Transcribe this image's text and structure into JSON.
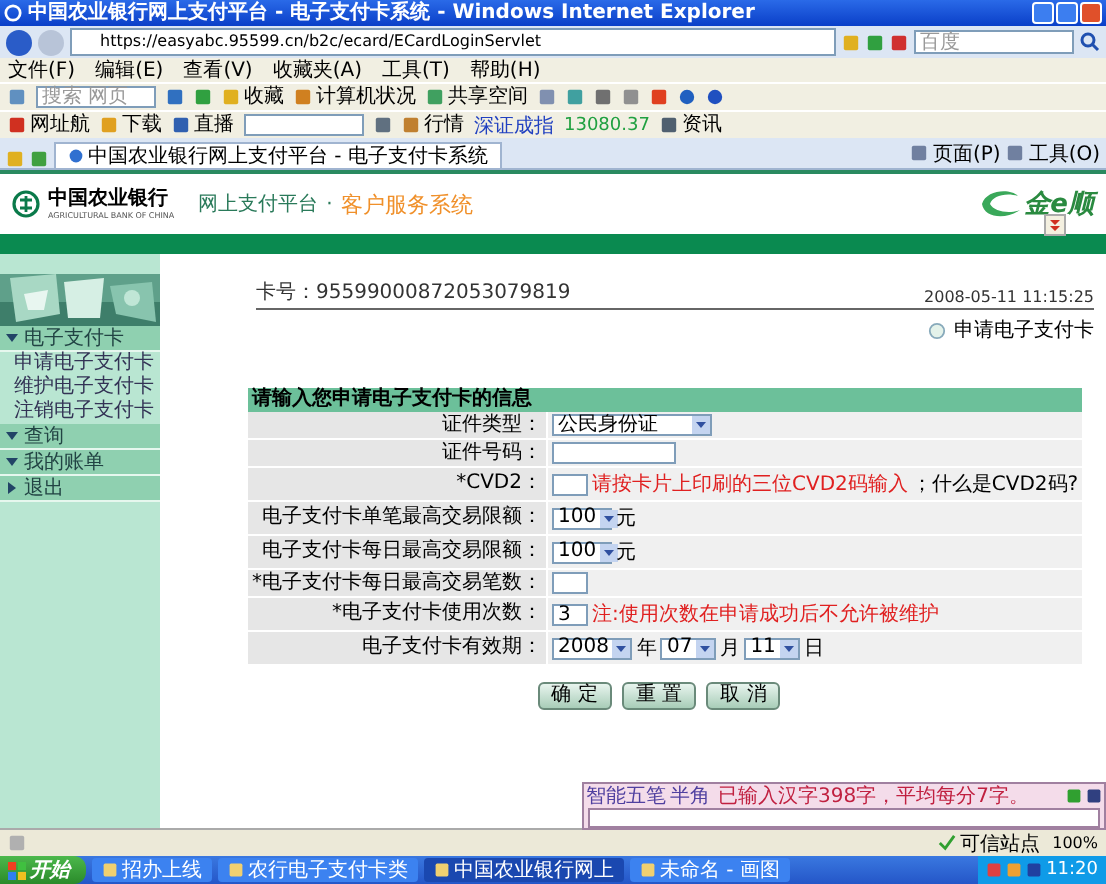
{
  "window": {
    "title": "中国农业银行网上支付平台 - 电子支付卡系统 - Windows Internet Explorer"
  },
  "address_bar": {
    "url": "https://easyabc.95599.cn/b2c/ecard/ECardLoginServlet",
    "search_placeholder": "百度"
  },
  "menu": [
    "文件(F)",
    "编辑(E)",
    "查看(V)",
    "收藏夹(A)",
    "工具(T)",
    "帮助(H)"
  ],
  "toolbar": {
    "search_placeholder": "搜索 网页",
    "items": [
      "收藏",
      "计算机状况",
      "共享空间"
    ]
  },
  "toolbar2": {
    "items": [
      "网址航",
      "下载",
      "直播"
    ],
    "quote_label": "行情",
    "index_name": "深证成指",
    "index_value": "13080.37",
    "news": "资讯"
  },
  "tabs": [
    {
      "label": "中国农业银行网上支付平台 - 电子支付卡系统",
      "selected": true
    }
  ],
  "command_bar": [
    "页面(P)",
    "工具(O)"
  ],
  "bank_header": {
    "bank_name": "中国农业银行",
    "bank_name_en": "AGRICULTURAL BANK OF CHINA",
    "platform": "网上支付平台",
    "separator": "·",
    "system": "客户服务系统",
    "brand": "金e顺"
  },
  "sidebar": {
    "sections": [
      {
        "label": "电子支付卡",
        "kind": "group",
        "expanded": true,
        "children": [
          {
            "label": "申请电子支付卡"
          },
          {
            "label": "维护电子支付卡"
          },
          {
            "label": "注销电子支付卡"
          }
        ]
      },
      {
        "label": "查询",
        "kind": "group"
      },
      {
        "label": "我的账单",
        "kind": "group"
      },
      {
        "label": "退出",
        "kind": "action"
      }
    ]
  },
  "card_info": {
    "card_number_label": "卡号：",
    "card_number": "95599000872053079819",
    "datetime": "2008-05-11 11:15:25"
  },
  "page_title": "申请电子支付卡",
  "form": {
    "heading": "请输入您申请电子支付卡的信息",
    "rows": [
      {
        "label": "证件类型：",
        "kind": "select",
        "value": "公民身份证"
      },
      {
        "label": "证件号码：",
        "kind": "input"
      },
      {
        "label": "*CVD2：",
        "kind": "input",
        "hint": "请按卡片上印刷的三位CVD2码输入",
        "note": "；什么是CVD2码?"
      },
      {
        "label": "电子支付卡单笔最高交易限额：",
        "kind": "select",
        "value": "100",
        "unit": "元"
      },
      {
        "label": "电子支付卡每日最高交易限额：",
        "kind": "select",
        "value": "100",
        "unit": "元"
      },
      {
        "label": "*电子支付卡每日最高交易笔数：",
        "kind": "input"
      },
      {
        "label": "*电子支付卡使用次数：",
        "kind": "input",
        "value": "3",
        "hint": "注:使用次数在申请成功后不允许被维护"
      },
      {
        "label": "电子支付卡有效期：",
        "kind": "date",
        "parts": [
          {
            "value": "2008",
            "unit": "年"
          },
          {
            "value": "07",
            "unit": "月"
          },
          {
            "value": "11",
            "unit": "日"
          }
        ]
      }
    ],
    "buttons": [
      "确 定",
      "重 置",
      "取 消"
    ]
  },
  "ime_bar": {
    "mode": "智能五笔",
    "width": "半角",
    "message": "已输入汉字398字，平均每分7字。"
  },
  "status_bar": {
    "zone": "可信站点",
    "zoom": "100%"
  },
  "taskbar": {
    "start": "开始",
    "tasks": [
      {
        "label": "招办上线",
        "selected": false
      },
      {
        "label": "农行电子支付卡类",
        "selected": false
      },
      {
        "label": "中国农业银行网上",
        "selected": true
      },
      {
        "label": "未命名 - 画图",
        "selected": false
      }
    ],
    "clock": "11:20"
  }
}
